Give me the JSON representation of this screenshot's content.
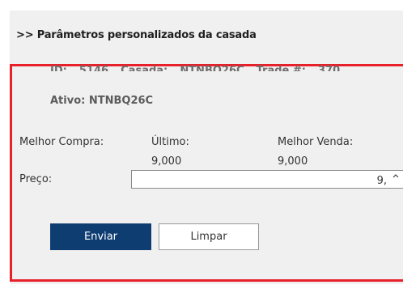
{
  "header": {
    "title": ">> Parâmetros personalizados da casada"
  },
  "info": {
    "id_label": "ID:",
    "id_value": "5146",
    "casada_label": "Casada:",
    "casada_value": "NTNBQ26C",
    "trade_label": "Trade #:",
    "trade_value": "370",
    "ativo": "Ativo: NTNBQ26C"
  },
  "quotes": {
    "best_buy_label": "Melhor Compra:",
    "last_label": "Último:",
    "last_value": "9,000",
    "best_sell_label": "Melhor Venda:",
    "best_sell_value": "9,000"
  },
  "price": {
    "label": "Preço:",
    "value": "9,"
  },
  "buttons": {
    "send_label": "Enviar",
    "clear_label": "Limpar"
  },
  "colors": {
    "frame": "#e8202a",
    "send_button": "#0e3d72",
    "panel_bg": "#f0f0f0"
  },
  "icons": {
    "spin": "spin-up-arrow-icon"
  }
}
